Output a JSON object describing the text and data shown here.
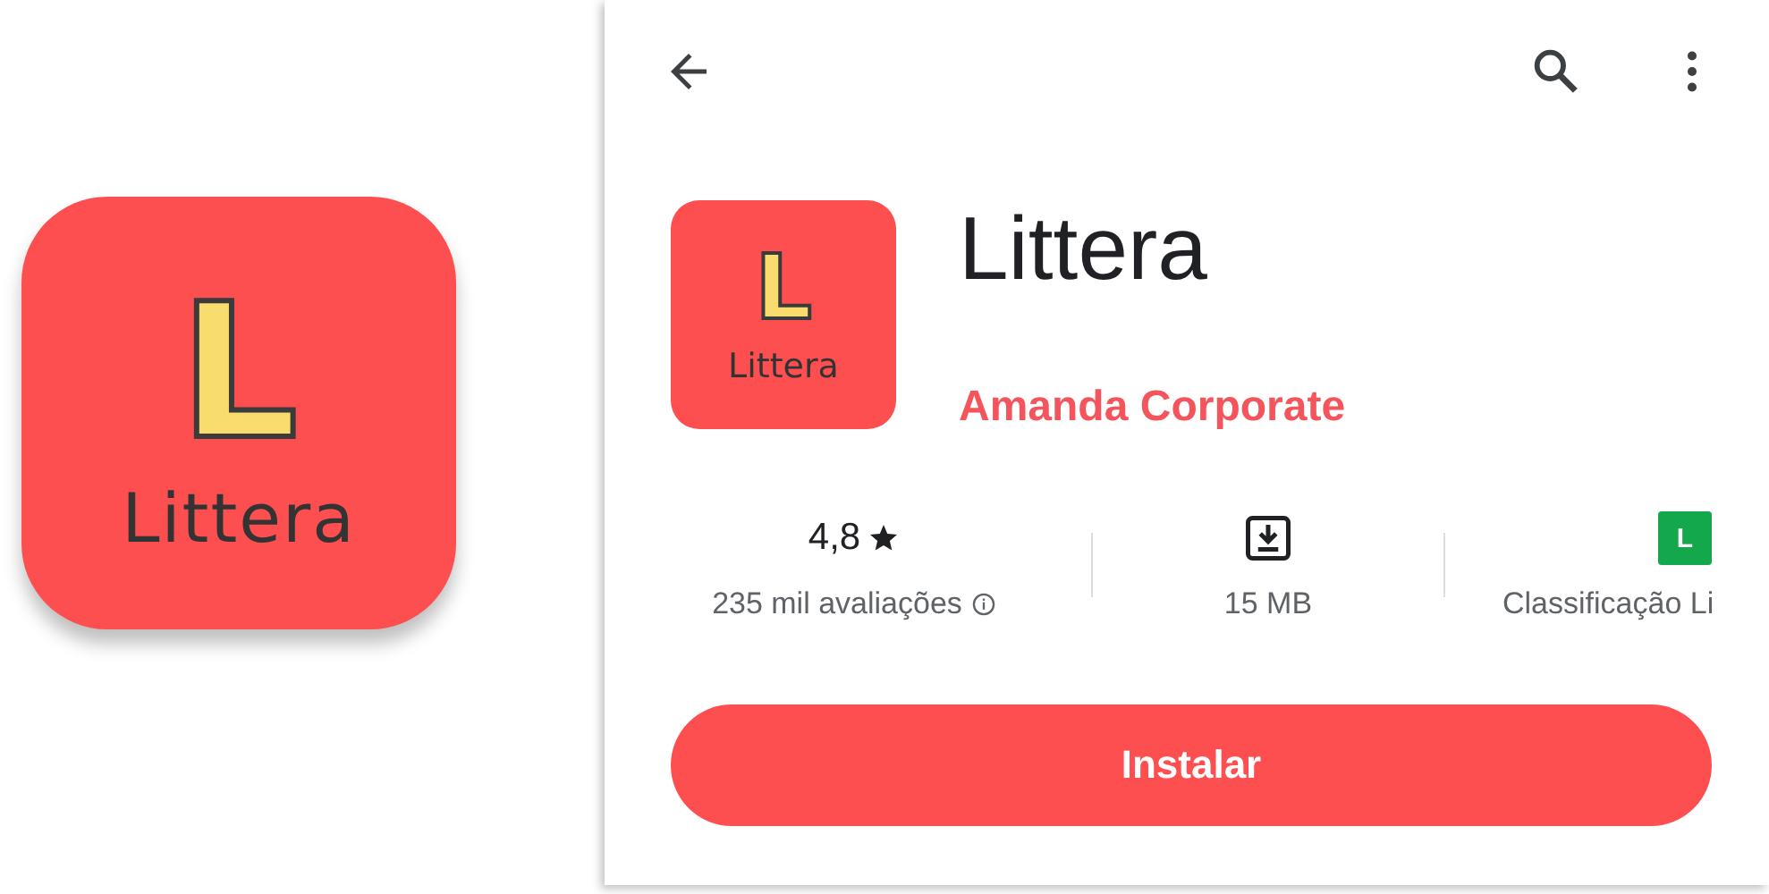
{
  "hero_icon": {
    "letter": "L",
    "name": "Littera"
  },
  "app": {
    "icon": {
      "letter": "L",
      "name": "Littera"
    },
    "title": "Littera",
    "developer": "Amanda Corporate"
  },
  "stats": [
    {
      "kind": "rating",
      "value": "4,8",
      "label": "235 mil avaliações"
    },
    {
      "kind": "size",
      "label": "15 MB"
    },
    {
      "kind": "content_rating",
      "badge": "L",
      "label": "Classificação Li"
    }
  ],
  "install_button": "Instalar"
}
